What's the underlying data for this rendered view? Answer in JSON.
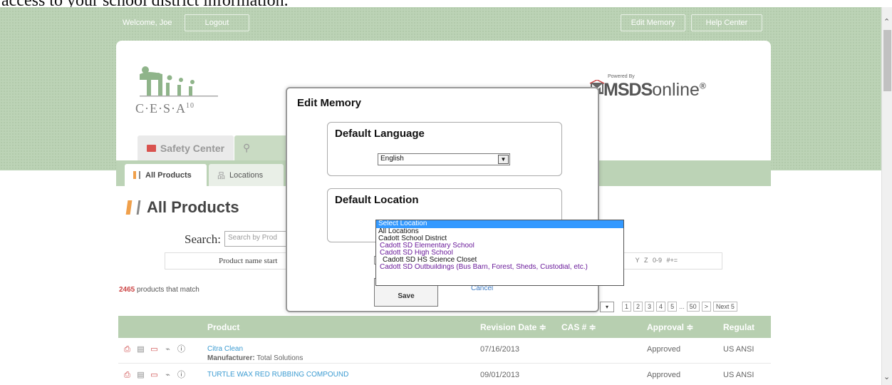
{
  "header": {
    "top_text": "access to your school district information.",
    "welcome": "Welcome, Joe",
    "logout": "Logout",
    "edit_memory": "Edit Memory",
    "help_center": "Help Center"
  },
  "brand": {
    "logo_text": "C·E·S·A",
    "logo_sup": "10",
    "powered_by": "Powered By",
    "msds_bold": "MSDS",
    "msds_light": "online",
    "reg": "®"
  },
  "tabs": {
    "safety": "Safety Center",
    "search_partial": "Q"
  },
  "subtabs": {
    "all_products": "All Products",
    "locations": "Locations"
  },
  "main": {
    "page_title": "All Products",
    "search_label": "Search:",
    "search_placeholder": "Search by Prod",
    "alpha_left": "Product name start",
    "alpha_right": "Y  Z  0-9  #+=",
    "count_num": "2465",
    "count_text": " products that match",
    "pages": [
      "1",
      "2",
      "3",
      "4",
      "5",
      "...",
      "50",
      ">",
      "Next 5"
    ]
  },
  "table": {
    "headers": {
      "product": "Product",
      "revision": "Revision Date ≑",
      "cas": "CAS # ≑",
      "approval": "Approval ≑",
      "regulat": "Regulat"
    },
    "rows": [
      {
        "name": "Citra Clean",
        "mfr_label": "Manufacturer:",
        "mfr": " Total Solutions",
        "date": "07/16/2013",
        "approval": "Approved",
        "reg": "US ANSI"
      },
      {
        "name": "TURTLE WAX RED RUBBING COMPOUND",
        "mfr_label": "",
        "mfr": "",
        "date": "09/01/2013",
        "approval": "Approved",
        "reg": "US ANSI"
      }
    ]
  },
  "modal": {
    "title": "Edit Memory",
    "lang_title": "Default Language",
    "lang_value": "English",
    "loc_title": "Default Location",
    "save": "Save",
    "cancel": "Cancel",
    "location_options": [
      "Select Location",
      "All Locations",
      "Cadott School District",
      " Cadott SD Elementary School",
      " Cadott SD High School",
      "  Cadott SD HS Science Closet",
      " Cadott SD Outbuildings (Bus Barn, Forest, Sheds, Custodial, etc.)"
    ]
  },
  "colors": {
    "green_band": "#bcd3b6",
    "table_header": "#b7cfb0",
    "link_blue": "#3b9bd1",
    "select_highlight": "#3399ff",
    "count_red": "#cc4444"
  }
}
